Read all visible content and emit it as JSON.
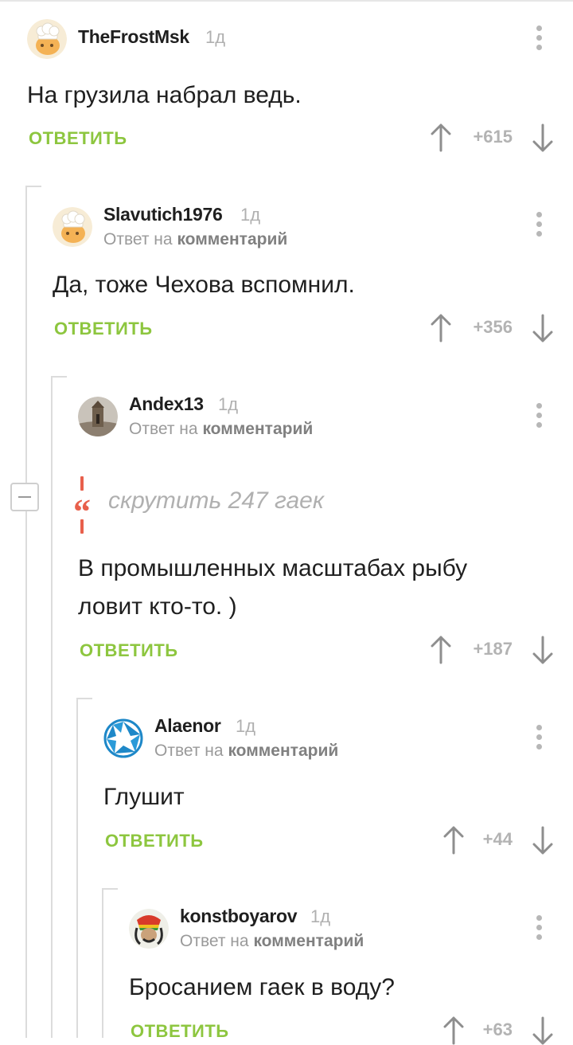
{
  "reply_label": "ОТВЕТИТЬ",
  "reply_prefix": "Ответ на",
  "reply_target": "комментарий",
  "spoiler": {
    "text": "скрутить 247 гаек"
  },
  "colors": {
    "accent": "#8dc63f",
    "spoiler": "#e8604c",
    "muted": "#b0b0b0"
  },
  "comments": [
    {
      "username": "TheFrostMsk",
      "time": "1д",
      "text": [
        "На грузила набрал ведь."
      ],
      "score": "+615",
      "avatar": "chef-hat-avatar"
    },
    {
      "username": "Slavutich1976",
      "time": "1д",
      "text": [
        "Да, тоже Чехова вспомнил."
      ],
      "score": "+356",
      "avatar": "chef-hat-avatar"
    },
    {
      "username": "Andex13",
      "time": "1д",
      "text": [
        "В промышленных масштабах рыбу",
        "ловит кто-то. )"
      ],
      "score": "+187",
      "avatar": "tower-photo-avatar"
    },
    {
      "username": "Alaenor",
      "time": "1д",
      "text": [
        "Глушит"
      ],
      "score": "+44",
      "avatar": "aperture-logo-avatar"
    },
    {
      "username": "konstboyarov",
      "time": "1д",
      "text": [
        "Бросанием гаек в воду?"
      ],
      "score": "+63",
      "avatar": "rasta-face-avatar"
    }
  ]
}
